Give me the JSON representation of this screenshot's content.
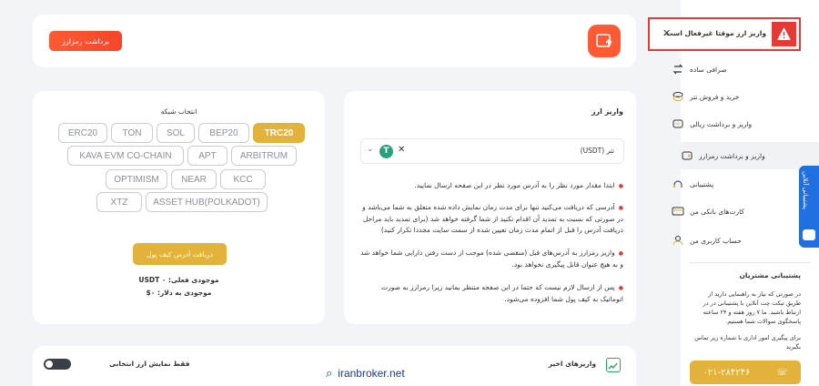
{
  "alert": {
    "text": "واریز ارز موقتا غیرفعال است."
  },
  "withdraw_button": "برداشت رمزارز",
  "deposit": {
    "title": "واریز ارز",
    "currency": "تتر (USDT)",
    "bullets": [
      "ابتدا مقدار مورد نظر را به آدرس مورد نظر در این صفحه ارسال نمایید.",
      "آدرسی که دریافت می‌کنید تنها برای مدت زمان نمایش داده شده متعلق به شما می‌باشد و در صورتی که نسبت به تمدید آن اقدام نکنید از شما گرفته خواهد شد (برای تمدید باید مراحل دریافت آدرس را قبل از اتمام مدت زمان تعیین شده از سمت سایت مجددا تکرار کنید)",
      "واریز رمزارز به آدرس‌های قبل (منقضی شده) موجب از دست رفتن دارایی شما خواهد شد و به هیچ عنوان قابل پیگیری نخواهد بود.",
      "پس از ارسال لازم نیست که حتما در این صفحه منتظر بمانید زیرا رمزارز به صورت اتوماتیک به کیف پول شما افزوده می‌شود."
    ]
  },
  "network": {
    "title": "انتخاب شبکه",
    "chips": [
      "TRC20",
      "BEP20",
      "SOL",
      "TON",
      "ERC20",
      "ARBITRUM",
      "APT",
      "KAVA EVM CO-CHAIN",
      "KCC",
      "NEAR",
      "OPTIMISM",
      "ASSET HUB(POLKADOT)",
      "XTZ"
    ],
    "get_address": "دریافت آدرس کیف پول",
    "balance_label": "موجودی فعلی: USDT ۰",
    "balance_usd": "موجودی به دلار: ۰$"
  },
  "recent": {
    "title": "واریزهای اخیر",
    "toggle_label": "فقط نمایش ارز انتخابی"
  },
  "watermark": "iranbroker.net",
  "sidebar": {
    "items": [
      {
        "label": "صرافی ساده"
      },
      {
        "label": "خرید و فروش تتر"
      },
      {
        "label": "واریز و برداشت ریالی"
      },
      {
        "label": "واریز و برداشت رمزارز"
      },
      {
        "label": "پشتیبانی"
      },
      {
        "label": "کارت‌های بانکی من"
      },
      {
        "label": "حساب کاربری من"
      }
    ],
    "support_title": "پشتیبانی مشتریان",
    "support_text": "در صورتی که نیاز به راهنمایی دارید از طریق تیکت چت آنلاین با پشتیبانی در در ارتباط باشید. ما ۷ روز هفته و ۲۴ ساعته پاسخگوی سوالات شما هستیم.",
    "support_text2": "برای پیگیری امور اداری با شماره زیر تماس بگیرید",
    "phone": "۰۲۱-۲۸۴۲۴۶",
    "online_support": "پشتیبانی آنلاین"
  }
}
